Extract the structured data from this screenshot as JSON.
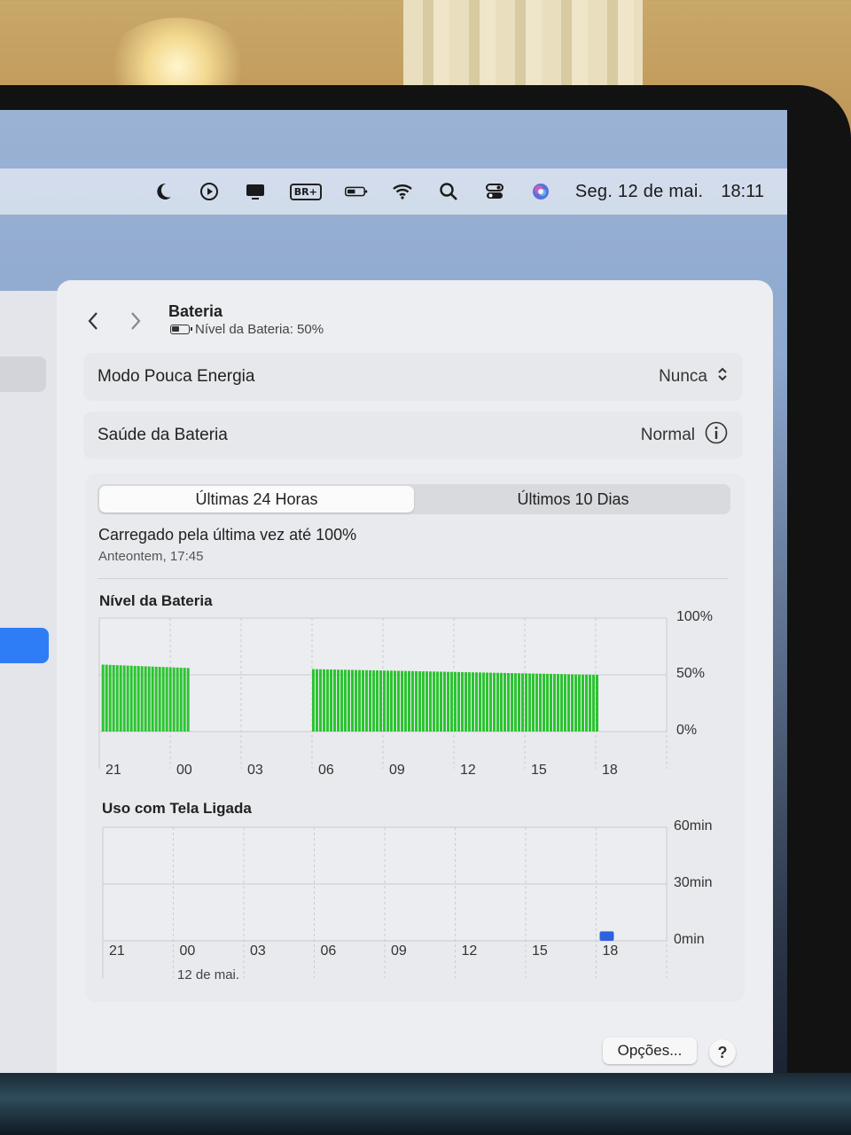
{
  "menubar": {
    "icons": [
      "moon-icon",
      "play-icon",
      "display-icon",
      "keyboard-input-icon",
      "battery-icon",
      "wifi-icon",
      "search-icon",
      "control-center-icon",
      "siri-icon"
    ],
    "input_source": "BR+",
    "date": "Seg. 12 de mai.",
    "time": "18:11"
  },
  "header": {
    "title": "Bateria",
    "subtitle": "Nível da Bateria: 50%"
  },
  "settings": {
    "low_power_label": "Modo Pouca Energia",
    "low_power_value": "Nunca",
    "health_label": "Saúde da Bateria",
    "health_value": "Normal"
  },
  "tabs": [
    {
      "label": "Últimas 24 Horas",
      "active": true
    },
    {
      "label": "Últimos 10 Dias",
      "active": false
    }
  ],
  "last_charge": {
    "text": "Carregado pela última vez até 100%",
    "time": "Anteontem, 17:45"
  },
  "colors": {
    "battery_bar": "#2bc431",
    "screen_bar": "#2f62e0",
    "accent": "#2f7df6"
  },
  "chart_data": [
    {
      "type": "bar",
      "title": "Nível da Bateria",
      "xlabel": "",
      "ylabel": "",
      "x_ticks": [
        "21",
        "00",
        "03",
        "06",
        "09",
        "12",
        "15",
        "18"
      ],
      "y_ticks": [
        "100%",
        "50%",
        "0%"
      ],
      "ylim": [
        0,
        100
      ],
      "grid": true,
      "segments": [
        {
          "start_hour": 21.1,
          "end_hour": 0.9,
          "start_value": 59,
          "end_value": 56,
          "unit": "%"
        },
        {
          "start_hour": 6.0,
          "end_hour": 18.2,
          "start_value": 55,
          "end_value": 50,
          "unit": "%"
        }
      ]
    },
    {
      "type": "bar",
      "title": "Uso com Tela Ligada",
      "xlabel": "",
      "ylabel": "",
      "x_ticks": [
        "21",
        "00",
        "03",
        "06",
        "09",
        "12",
        "15",
        "18"
      ],
      "y_ticks": [
        "60min",
        "30min",
        "0min"
      ],
      "ylim": [
        0,
        60
      ],
      "grid": true,
      "date_label": "12 de mai.",
      "bars": [
        {
          "hour": 18,
          "minutes": 5
        }
      ]
    }
  ],
  "buttons": {
    "options": "Opções...",
    "help": "?"
  }
}
